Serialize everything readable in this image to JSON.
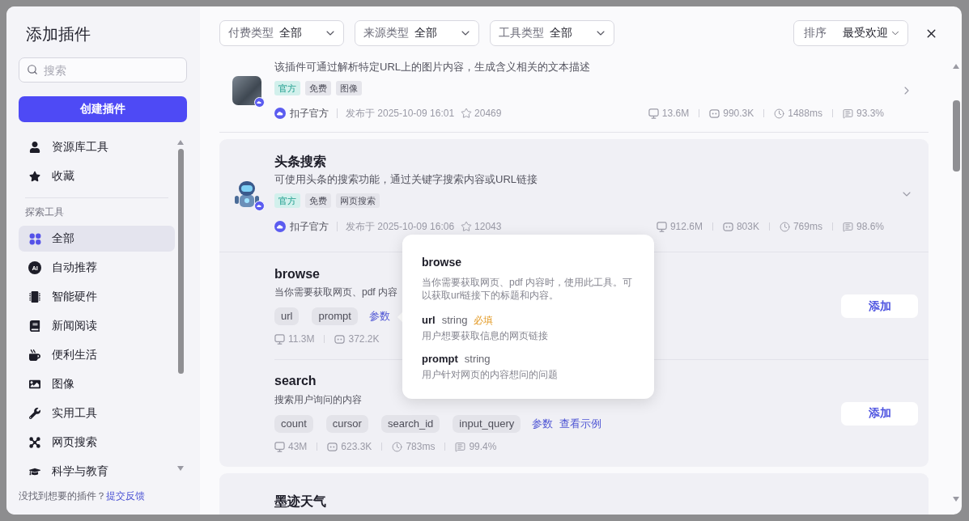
{
  "sidebar": {
    "title": "添加插件",
    "search": {
      "placeholder": "搜索"
    },
    "create_button": "创建插件",
    "library": [
      {
        "label": "资源库工具",
        "selected": false
      },
      {
        "label": "收藏",
        "selected": false
      }
    ],
    "section_label": "探索工具",
    "categories": [
      {
        "label": "全部",
        "selected": true
      },
      {
        "label": "自动推荐",
        "selected": false,
        "badge": "AI"
      },
      {
        "label": "智能硬件",
        "selected": false
      },
      {
        "label": "新闻阅读",
        "selected": false
      },
      {
        "label": "便利生活",
        "selected": false
      },
      {
        "label": "图像",
        "selected": false
      },
      {
        "label": "实用工具",
        "selected": false
      },
      {
        "label": "网页搜索",
        "selected": false
      },
      {
        "label": "科学与教育",
        "selected": false
      }
    ],
    "footer": {
      "text": "没找到想要的插件？",
      "link": "提交反馈"
    }
  },
  "filters": [
    {
      "label": "付费类型",
      "value": "全部"
    },
    {
      "label": "来源类型",
      "value": "全部"
    },
    {
      "label": "工具类型",
      "value": "全部"
    }
  ],
  "sort": {
    "label": "排序",
    "value": "最受欢迎"
  },
  "plugins": [
    {
      "description": "该插件可通过解析特定URL上的图片内容，生成含义相关的文本描述",
      "avatar": {
        "kind": "photo"
      },
      "tags": [
        {
          "label": "官方",
          "kind": "official"
        },
        {
          "label": "免费",
          "kind": "plain"
        },
        {
          "label": "图像",
          "kind": "plain"
        }
      ],
      "publisher": "扣子官方",
      "published": "发布于 2025-10-09 16:01",
      "favorites": "20469",
      "stats": [
        "13.6M",
        "990.3K",
        "1488ms",
        "93.3%"
      ],
      "expanded": false,
      "shaded": false
    },
    {
      "title": "头条搜索",
      "description": "可使用头条的搜索功能，通过关键字搜索内容或URL链接",
      "avatar": {
        "kind": "robot"
      },
      "tags": [
        {
          "label": "官方",
          "kind": "official"
        },
        {
          "label": "免费",
          "kind": "plain"
        },
        {
          "label": "网页搜索",
          "kind": "plain"
        }
      ],
      "publisher": "扣子官方",
      "published": "发布于 2025-10-09 16:06",
      "favorites": "12043",
      "stats": [
        "912.6M",
        "803K",
        "769ms",
        "98.6%"
      ],
      "expanded": true,
      "shaded": true,
      "tools": [
        {
          "name": "browse",
          "description": "当你需要获取网页、pdf 内容",
          "params": [
            "url",
            "prompt"
          ],
          "links": [
            "参数"
          ],
          "stats": [
            "11.3M",
            "372.2K"
          ],
          "add_button": "添加"
        },
        {
          "name": "search",
          "description": "搜索用户询问的内容",
          "params": [
            "count",
            "cursor",
            "search_id",
            "input_query"
          ],
          "links": [
            "参数",
            "查看示例"
          ],
          "stats": [
            "43M",
            "623.3K",
            "783ms",
            "99.4%"
          ],
          "add_button": "添加"
        }
      ]
    },
    {
      "title": "墨迹天气",
      "shaded": true
    }
  ],
  "tooltip": {
    "title": "browse",
    "description": "当你需要获取网页、pdf 内容时，使用此工具。可以获取url链接下的标题和内容。",
    "params": [
      {
        "name": "url",
        "type": "string",
        "badge": "必填",
        "description": "用户想要获取信息的网页链接"
      },
      {
        "name": "prompt",
        "type": "string",
        "description": "用户针对网页的内容想问的问题"
      }
    ]
  }
}
